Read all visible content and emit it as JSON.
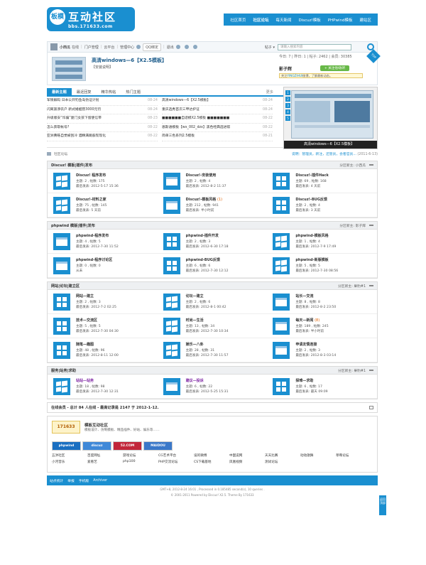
{
  "logo": {
    "badge": "板模",
    "title": "互动社区",
    "sub": "bbs.171633.com"
  },
  "topnav": [
    "社区首页",
    "社区论坛",
    "每天新闻",
    "Discuz!模板",
    "PHPwind模板",
    "建站区"
  ],
  "userbar": {
    "name": "小西瓜",
    "online": "在线",
    "items": [
      "门户管理",
      "云平台",
      "管理中心"
    ],
    "qq": "QQ绑定",
    "logout": "退出",
    "search_type": "帖子 ▾",
    "search_placeholder": "请输入搜索内容"
  },
  "featured": {
    "title": "高清windows—6【X2.5模板】",
    "sub": "【安装说明】",
    "stats_label": "今日: 7 | 昨日: 1 | 帖子: 2462 | 会员: 30385",
    "user": "影子辉",
    "follow": "+ 关注他/收听",
    "notice_pre": "关注",
    "notice_link": "YINGZIHUI",
    "notice_post": "微博，了解最新动态。",
    "corner": "TOP"
  },
  "tabs": {
    "items": [
      "最新主题",
      "最近回复",
      "精华热帖",
      "热门主题"
    ],
    "more": "更多"
  },
  "news": {
    "left": [
      {
        "t": "军情解码 日本公开钓鱼岛伪证计划",
        "d": "08-24"
      },
      {
        "t": "闪离族添农户 新式婚姻营3000元罚",
        "d": "08-24"
      },
      {
        "t": "升级版安“诈骗”厦门女孩下留使信带",
        "d": "08-23"
      },
      {
        "t": "怎么获取帐号?",
        "d": "08-22"
      },
      {
        "t": "亚洲黄皓自觉被刮冷 酒精满跳般现现化",
        "d": "08-22"
      }
    ],
    "right": [
      {
        "t": "高清windows—6【X2.5模板】",
        "d": "08-24"
      },
      {
        "t": "重庆选秀首次三甲达护证",
        "d": "08-24"
      },
      {
        "t": "■■■■■■自适模X2.5模板 ■■■■■■■",
        "d": "08-22"
      },
      {
        "t": "恩斯通模板【wx_002_dzx】黑色经典选进帮",
        "d": "08-22"
      },
      {
        "t": "简单三色系列2.5模板",
        "d": "08-21"
      }
    ]
  },
  "slide": {
    "caption": "高清windows—6【X2.5模板】",
    "nums": [
      "1",
      "2",
      "3",
      "4",
      "5"
    ]
  },
  "crumb": {
    "label": "社区论坛",
    "right_pre": "说明：管理员，新注，还管员，会者官员...",
    "right_date": "(2011-6-13)"
  },
  "sections": [
    {
      "title": "Discuz! 模板|插件|发布",
      "mod": "分区新主: 小西瓜",
      "forums": [
        {
          "name": "Discuz! 程序发布",
          "c1": "主题: 2      , 帖数: 175",
          "c2": "最后发表: 2012-5-17 15:36"
        },
        {
          "name": "Discuz!-安装使用",
          "c1": "主题: 2      , 帖数: 4",
          "c2": "最后发表: 2012-8-2 11:37"
        },
        {
          "name": "Discuz!-插件Hack",
          "c1": "主题: 69     , 帖数: 168",
          "c2": "最后发表: 4 天前"
        },
        {
          "name": "Discuz!-材料之家",
          "c1": "主题: 75     , 帖数: 145",
          "c2": "最后发表: 5 天前"
        },
        {
          "name": "Discuz!-模板风格",
          "extra": "(1)",
          "c1": "主题: 212    , 帖数: 941",
          "c2": "最后发表: 半小时前"
        },
        {
          "name": "Discuz!-BUG反馈",
          "c1": "主题: 2      , 帖数: 4",
          "c2": "最后发表: 3 天前"
        }
      ]
    },
    {
      "title": "phpwind 模版|插件|发布",
      "mod": "分区新主: 影子辉",
      "forums": [
        {
          "name": "phpwind-程序发布",
          "c1": "主题: 4      , 帖数: 5",
          "c2": "最后发表: 2012-7-30 11:52"
        },
        {
          "name": "phpwind-插件开发",
          "c1": "主题: 2      , 帖数: 3",
          "c2": "最后发表: 2012-6-30 17:18"
        },
        {
          "name": "phpwind-模板风格",
          "c1": "主题: 1      , 帖数: 4",
          "c2": "最后发表: 2012-7-9 17:49"
        },
        {
          "name": "phpwind-程序讨论区",
          "c1": "主题: 0      , 帖数: 0",
          "c2": "从未"
        },
        {
          "name": "phpwind-BUG反馈",
          "c1": "主题: 6      , 帖数: 6",
          "c2": "最后发表: 2012-7-30 12:12"
        },
        {
          "name": "phpwind-新版模板",
          "c1": "主题: 5      , 帖数: 5",
          "c2": "最后发表: 2012-7-30 08:56"
        }
      ]
    },
    {
      "title": "网站|论坛|建立区",
      "mod": "分区新主: 果豹#1",
      "forums": [
        {
          "name": "网站—建立",
          "c1": "主题: 2      , 帖数: 3",
          "c2": "最后发表: 2012-7-2 02:25"
        },
        {
          "name": "论坛—建立",
          "c1": "主题: 2      , 帖数: 6",
          "c2": "最后发表: 2012-8-1 00:42"
        },
        {
          "name": "站长—交流",
          "c1": "主题: 8      , 帖数: 8",
          "c2": "最后发表: 2012-8-2 23:50"
        },
        {
          "name": "技术—交流区",
          "c1": "主题: 5      , 帖数: 5",
          "c2": "最后发表: 2012-7-30 04:30"
        },
        {
          "name": "时尚—生活",
          "c1": "主题: 13     , 帖数: 34",
          "c2": "最后发表: 2012-7-30 10:34"
        },
        {
          "name": "每天—新闻",
          "extra": "(8)",
          "c1": "主题: 189    , 帖数: 245",
          "c2": "最后发表: 半小时前"
        },
        {
          "name": "随笔—趣图",
          "c1": "主题: 48     , 帖数: 96",
          "c2": "最后发表: 2012-8-11 12:00"
        },
        {
          "name": "娱乐—八卦",
          "c1": "主题: 28     , 帖数: 31",
          "c2": "最后发表: 2012-7-30 11:57"
        },
        {
          "name": "申请友情连接",
          "c1": "主题: 2      , 帖数: 3",
          "c2": "最后发表: 2012-8-3 03:14"
        }
      ]
    },
    {
      "title": "服务|站务|求助",
      "mod": "分区新主: 果豹#1",
      "forums": [
        {
          "name": "站站—站务",
          "purple": true,
          "c1": "主题: 18     , 帖数: 98",
          "c2": "最后发表: 2012-7-30 12:31"
        },
        {
          "name": "建议—投诉",
          "purple": true,
          "c1": "主题: 6      , 帖数: 22",
          "c2": "最后发表: 2012-5-25 15:31"
        },
        {
          "name": "探难—求助",
          "c1": "主题: 6      , 帖数: 17",
          "c2": "最后发表: 最天 09:09"
        }
      ]
    }
  ],
  "online": "在线会员 - 总计 84 人在线 - 最高记录是 2147 于 2012-1-12.",
  "links": {
    "logo": "171633",
    "name": "模板互动社区",
    "desc": "模板设计、仿制模板、精品插件、好站、娱乐等……",
    "logos": [
      "phpwind",
      "discuz",
      "52.COM",
      "MAIDOU"
    ],
    "text": [
      "五洪社区",
      "百度网址",
      "游戏论坛",
      "CG艺术平台",
      "设的微博",
      "中国说网",
      "天天比赛",
      "动动歌舞",
      "草莓论坛",
      "小河音乐",
      "爱看艺",
      "php100",
      "PHP交流论坛",
      "CS下载基地",
      "凤凰视频",
      "测试论坛"
    ]
  },
  "side": "返回顶部",
  "footer": {
    "links": [
      "站点统计",
      "举报",
      "手机版",
      "Archiver"
    ],
    "copy1": "GMT+8, 2012-8-24 16:01 , Processed in 0.185485 second(s), 10 queries .",
    "copy2": "© 2001-2011 Powered by Discuz! X2.5. Theme By 171633"
  }
}
